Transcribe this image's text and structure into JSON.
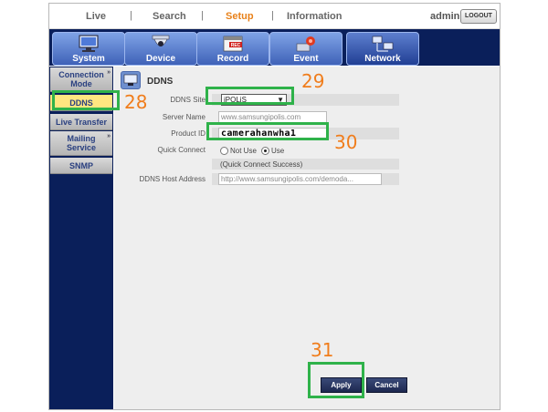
{
  "topnav": {
    "items": [
      {
        "label": "Live"
      },
      {
        "label": "Search"
      },
      {
        "label": "Setup"
      },
      {
        "label": "Information"
      }
    ],
    "separator": "|",
    "user": "admin",
    "logout_label": "LOGOUT"
  },
  "menubar": {
    "items": [
      {
        "label": "System"
      },
      {
        "label": "Device"
      },
      {
        "label": "Record"
      },
      {
        "label": "Event"
      },
      {
        "label": "Network"
      }
    ],
    "record_badge": "REC"
  },
  "leftnav": {
    "items": [
      {
        "label": "Connection Mode"
      },
      {
        "label": "DDNS"
      },
      {
        "label": "Live Transfer"
      },
      {
        "label": "Mailing Service"
      },
      {
        "label": "SNMP"
      }
    ],
    "expand_glyph": "»"
  },
  "form": {
    "title": "DDNS",
    "ddns_site_label": "DDNS Site",
    "ddns_site_value": "iPOLiS",
    "server_name_label": "Server Name",
    "server_name_value": "www.samsungipolis.com",
    "product_id_label": "Product ID",
    "product_id_value": "camerahanwha1",
    "quick_connect_label": "Quick Connect",
    "quick_connect_options": [
      "Not Use",
      "Use"
    ],
    "quick_connect_status": "(Quick Connect Success)",
    "ddns_host_label": "DDNS Host Address",
    "ddns_host_value": "http://www.samsungipolis.com/demoda..."
  },
  "buttons": {
    "apply": "Apply",
    "cancel": "Cancel"
  },
  "annotations": {
    "a28": "28",
    "a29": "29",
    "a30": "30",
    "a31": "31"
  },
  "colors": {
    "accent_orange": "#e8811a",
    "nav_dark": "#0a1f5a",
    "highlight_green": "#2fb24a",
    "annotation_orange": "#f07d1c",
    "selected_item": "#ffe680"
  }
}
